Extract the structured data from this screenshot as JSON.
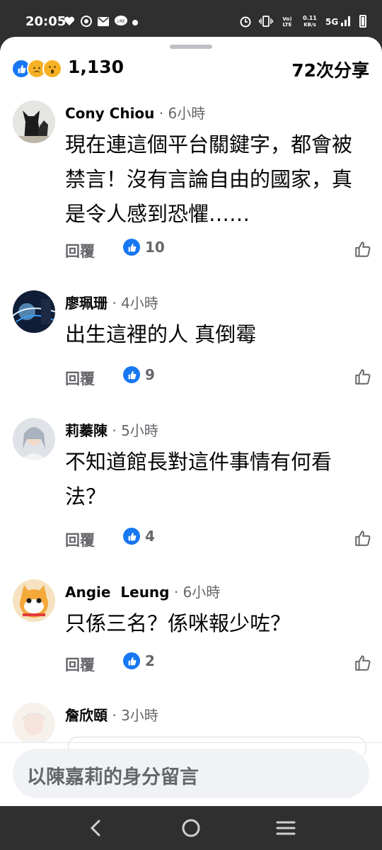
{
  "status_bar": {
    "time": "20:05",
    "icons_left": [
      "heart-icon",
      "chrome-icon",
      "mail-icon",
      "line-icon",
      "dot-icon"
    ],
    "icons_right": [
      "alarm-icon",
      "vibrate-icon",
      "volte-icon",
      "network-speed-icon",
      "5g-signal-icon",
      "battery-icon"
    ],
    "network_speed": "0.11\nKB/s",
    "network_type": "5G"
  },
  "summary": {
    "reaction_icons": [
      "like-reaction",
      "sad-reaction",
      "wow-reaction"
    ],
    "reaction_count": "1,130",
    "share_count": "72次分享"
  },
  "comments": [
    {
      "author": "Cony Chiou",
      "time": "· 6小時",
      "text": "現在連這個平台關鍵字，都會被禁言！沒有言論自由的國家，真是令人感到恐懼……",
      "reply": "回覆",
      "likes": "10"
    },
    {
      "author": "廖珮珊",
      "time": "· 4小時",
      "text": "出生這裡的人 真倒霉",
      "reply": "回覆",
      "likes": "9"
    },
    {
      "author": "莉蓁陳",
      "time": "· 5小時",
      "text": "不知道館長對這件事情有何看法？",
      "reply": "回覆",
      "likes": "4"
    },
    {
      "author": "Angie  Leung",
      "time": "· 6小時",
      "text": "只係三名？係咪報少咗？",
      "reply": "回覆",
      "likes": "2"
    },
    {
      "author": "詹欣頤",
      "time": "· 3小時"
    }
  ],
  "composer": {
    "placeholder": "以陳嘉莉的身分留言"
  },
  "colors": {
    "accent": "#1877f2",
    "secondary_text": "#65676b",
    "system_bar": "#2f2f2f"
  }
}
